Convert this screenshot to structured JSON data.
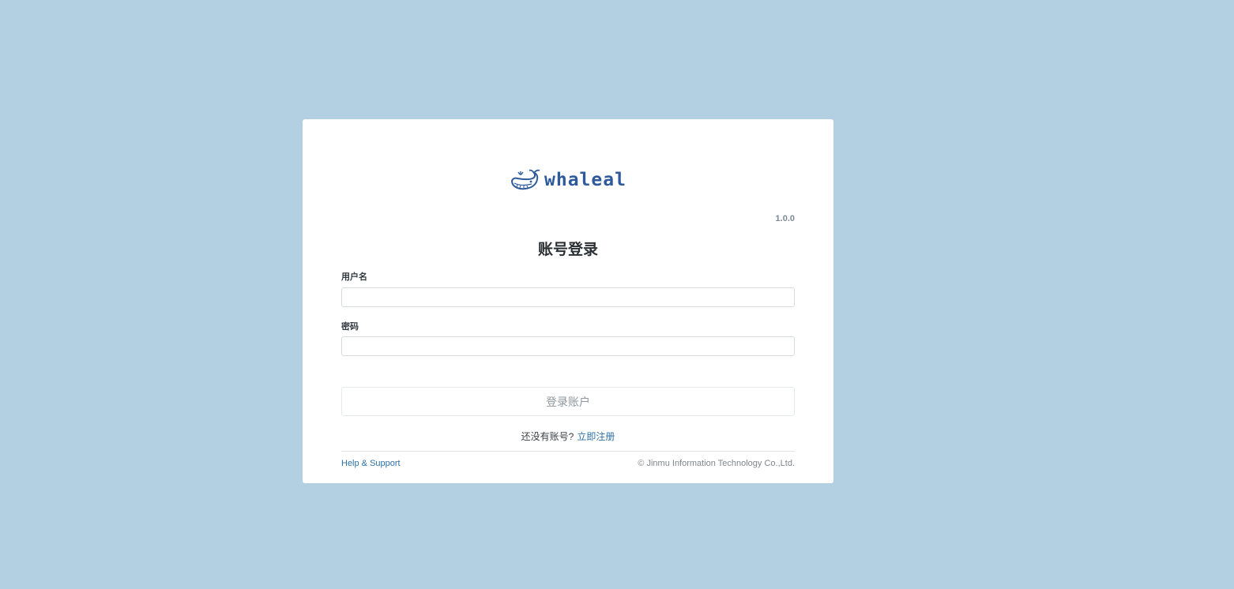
{
  "brand": {
    "logo_text": "whaleal",
    "icon": "whale-logo-icon",
    "color": "#2e5a9c"
  },
  "version": "1.0.0",
  "login": {
    "title": "账号登录",
    "username_label": "用户名",
    "username_value": "",
    "password_label": "密码",
    "password_value": "",
    "submit_label": "登录账户",
    "no_account_text": "还没有账号?",
    "register_link": "立即注册"
  },
  "footer": {
    "help_link": "Help & Support",
    "copyright": "© Jinmu Information Technology Co.,Ltd."
  },
  "colors": {
    "background": "#b3cfe2",
    "link": "#2d6fa3"
  }
}
